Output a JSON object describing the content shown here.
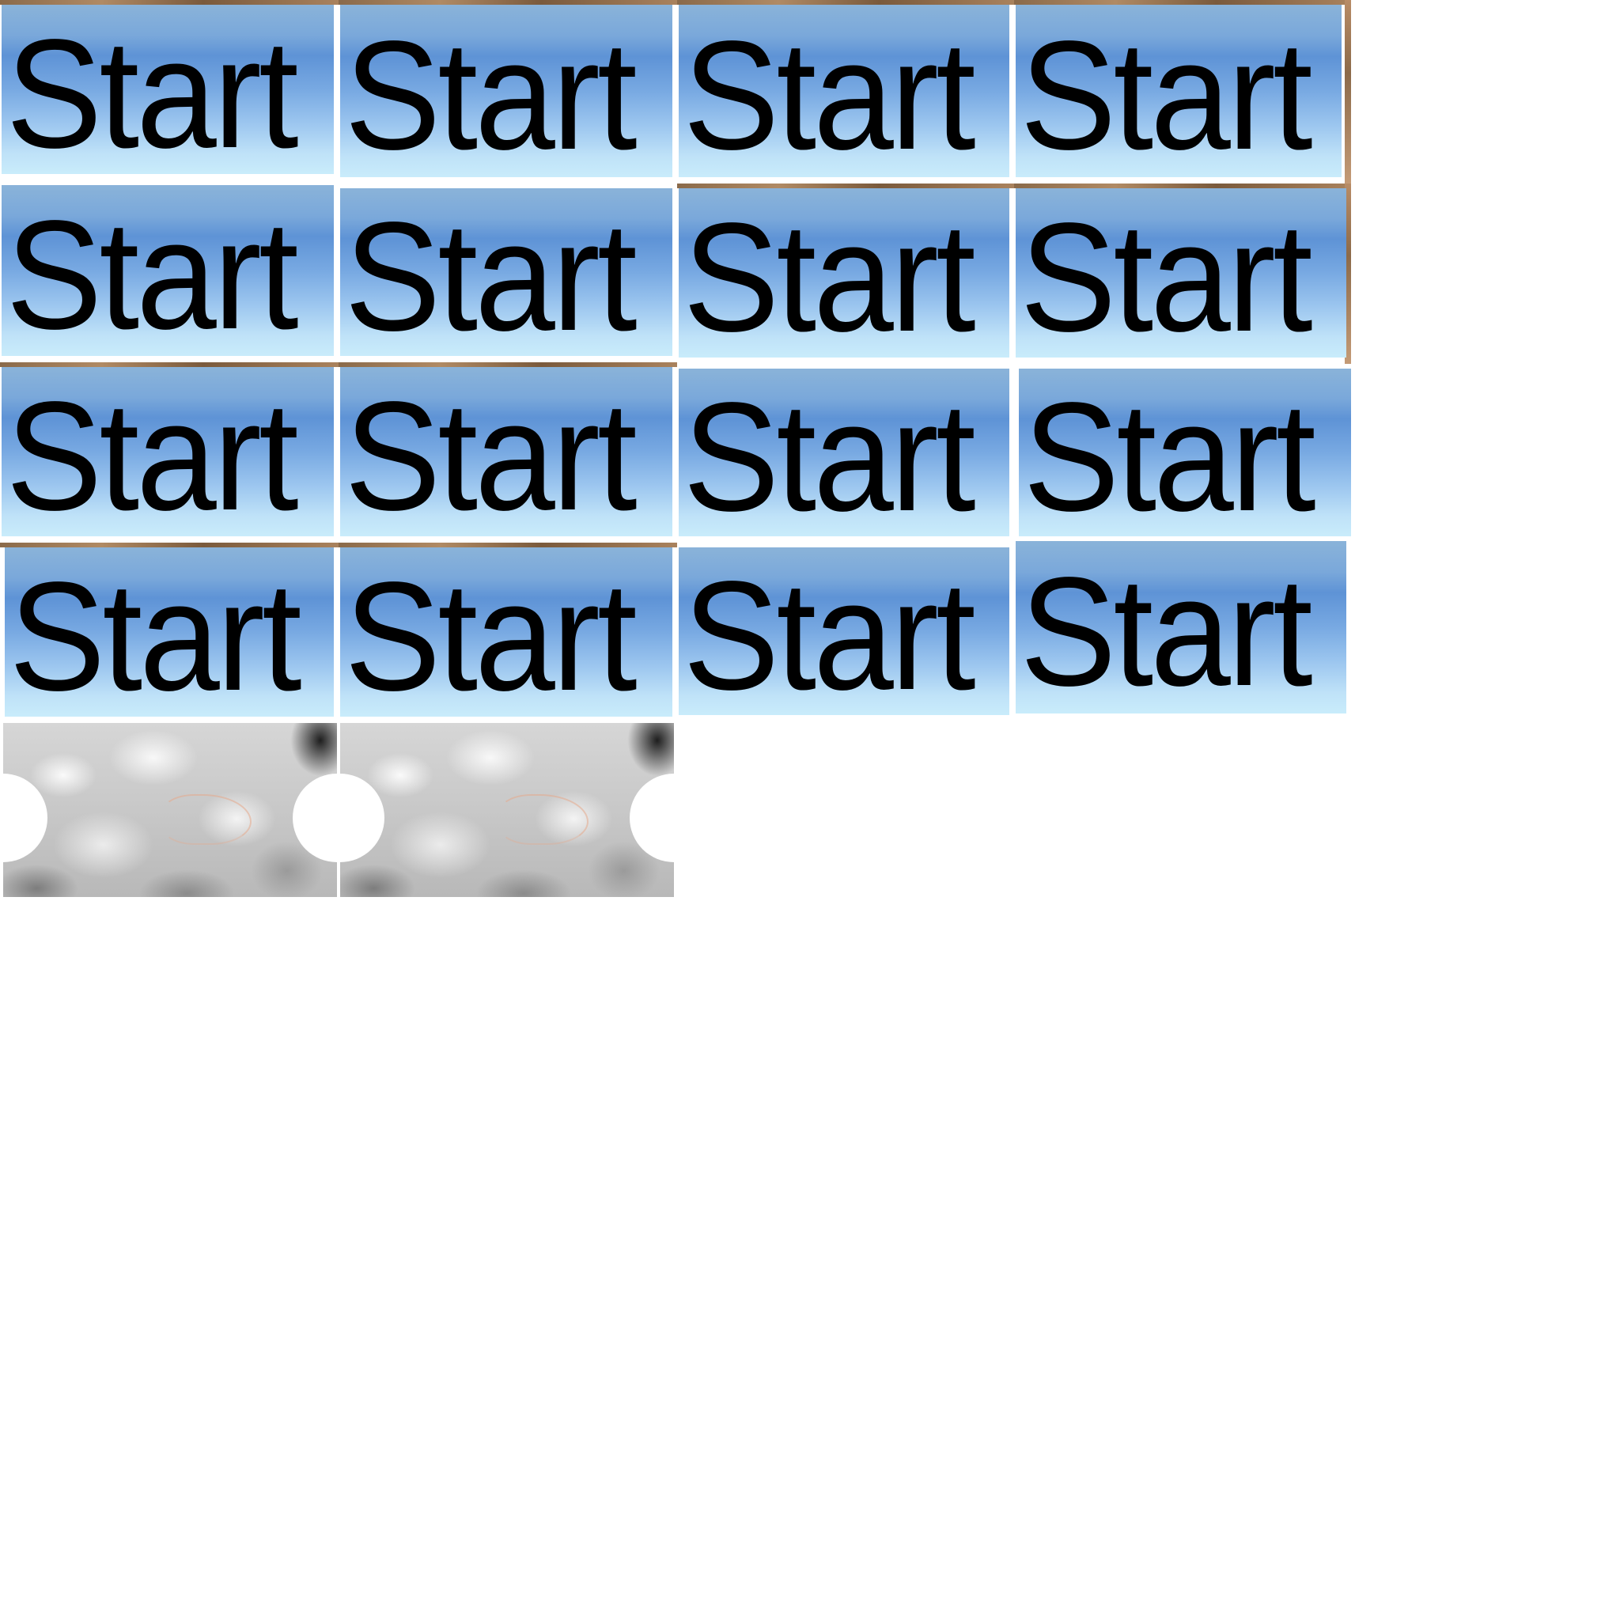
{
  "sprite_sheet": {
    "buttons": [
      {
        "label": "Start"
      },
      {
        "label": "Start"
      },
      {
        "label": "Start"
      },
      {
        "label": "Start"
      },
      {
        "label": "Start"
      },
      {
        "label": "Start"
      },
      {
        "label": "Start"
      },
      {
        "label": "Start"
      },
      {
        "label": "Start"
      },
      {
        "label": "Start"
      },
      {
        "label": "Start"
      },
      {
        "label": "Start"
      },
      {
        "label": "Start"
      },
      {
        "label": "Start"
      },
      {
        "label": "Start"
      },
      {
        "label": "Start"
      }
    ],
    "button_style": {
      "gradient_top": "#7aa8da",
      "gradient_bottom": "#c9ecfb",
      "text_color": "#000000"
    },
    "cloud_panels": [
      {
        "name": "cloud-panel"
      },
      {
        "name": "cloud-panel"
      }
    ]
  }
}
